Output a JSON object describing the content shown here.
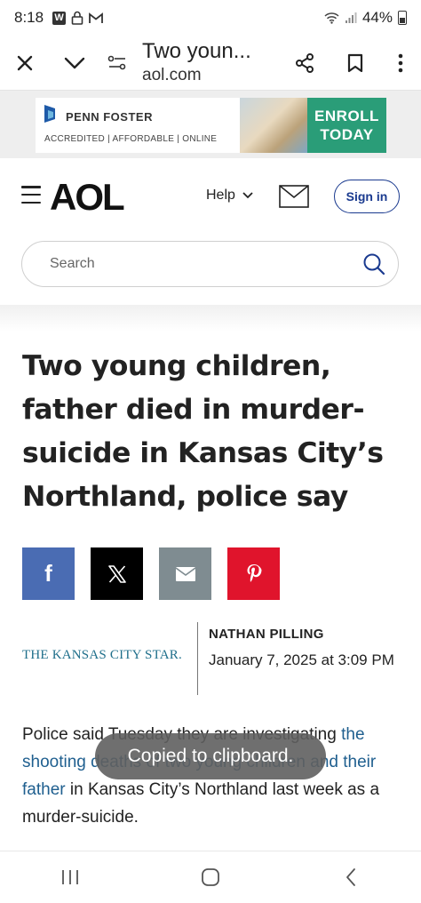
{
  "status_bar": {
    "time": "8:18",
    "notification_w": "W",
    "battery": "44%",
    "icons": [
      "w-app-icon",
      "lock-icon",
      "gmail-icon",
      "wifi-icon",
      "signal-icon",
      "battery-icon"
    ]
  },
  "browser": {
    "page_title": "Two youn...",
    "domain": "aol.com",
    "icons": [
      "close-icon",
      "chevron-down-icon",
      "site-settings-icon",
      "share-icon",
      "bookmark-icon",
      "more-icon"
    ]
  },
  "ad": {
    "brand": "PENN FOSTER",
    "tagline": "ACCREDITED | AFFORDABLE | ONLINE",
    "cta_line1": "ENROLL",
    "cta_line2": "TODAY",
    "cta_color": "#2a9d78"
  },
  "header": {
    "logo": "AOL",
    "help_label": "Help",
    "signin_label": "Sign in",
    "accent": "#1a3a8f"
  },
  "search": {
    "placeholder": "Search"
  },
  "article": {
    "headline": "Two young children, father died in murder-suicide in Kansas City’s Northland, police say",
    "share": {
      "facebook": "f",
      "colors": {
        "facebook": "#4a6cb3",
        "x": "#000000",
        "email": "#7f8c91",
        "pinterest": "#e0142c"
      }
    },
    "source": "THE KANSAS CITY STAR.",
    "author": "NATHAN PILLING",
    "date": "January 7, 2025 at 3:09 PM",
    "body": {
      "part1": "Police said Tuesday they are investigating ",
      "link": "the shooting deaths of two young children and their father",
      "part2": " in Kansas City’s Northland last week as a murder-suicide."
    }
  },
  "toast": {
    "message": "Copied to clipboard."
  },
  "nav": {
    "icons": [
      "recent-apps-icon",
      "home-icon",
      "back-icon"
    ]
  }
}
